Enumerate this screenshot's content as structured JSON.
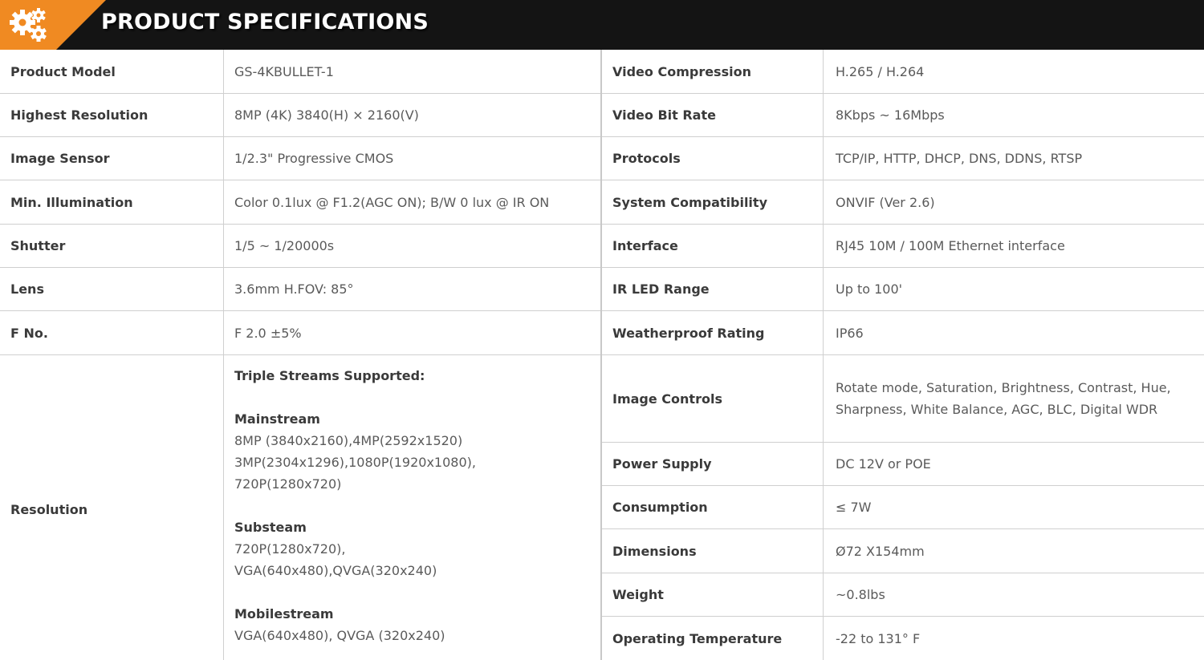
{
  "header": {
    "title": "PRODUCT SPECIFICATIONS",
    "accent_color": "#f08a22",
    "icon": "gears-icon"
  },
  "left_specs": [
    {
      "label": "Product Model",
      "value": "GS-4KBULLET-1"
    },
    {
      "label": "Highest Resolution",
      "value": "8MP (4K)  3840(H) × 2160(V)"
    },
    {
      "label": "Image Sensor",
      "value": "1/2.3\" Progressive CMOS"
    },
    {
      "label": "Min. Illumination",
      "value": "Color 0.1lux @ F1.2(AGC ON);  B/W 0 lux @ IR ON"
    },
    {
      "label": "Shutter",
      "value": "1/5 ~ 1/20000s"
    },
    {
      "label": "Lens",
      "value": "3.6mm H.FOV: 85°"
    },
    {
      "label": "F No.",
      "value": "F 2.0 ±5%"
    }
  ],
  "resolution": {
    "label": "Resolution",
    "heading": "Triple Streams Supported:",
    "main_title": "Mainstream",
    "main_lines": [
      "8MP (3840x2160),4MP(2592x1520)",
      "3MP(2304x1296),1080P(1920x1080),",
      "720P(1280x720)"
    ],
    "sub_title": "Substeam",
    "sub_lines": [
      "720P(1280x720),",
      "VGA(640x480),QVGA(320x240)"
    ],
    "mobile_title": "Mobilestream",
    "mobile_lines": [
      "VGA(640x480), QVGA (320x240)"
    ]
  },
  "right_specs": [
    {
      "label": "Video Compression",
      "value": "H.265 / H.264"
    },
    {
      "label": "Video Bit Rate",
      "value": "8Kbps ~ 16Mbps"
    },
    {
      "label": "Protocols",
      "value": "TCP/IP, HTTP, DHCP, DNS, DDNS, RTSP"
    },
    {
      "label": "System Compatibility",
      "value": "ONVIF (Ver 2.6)"
    },
    {
      "label": "Interface",
      "value": "RJ45 10M / 100M Ethernet interface"
    },
    {
      "label": "IR LED Range",
      "value": "Up to 100'"
    },
    {
      "label": "Weatherproof Rating",
      "value": "IP66"
    }
  ],
  "image_controls": {
    "label": "Image Controls",
    "lines": [
      "Rotate mode, Saturation, Brightness, Contrast, Hue,",
      "Sharpness, White Balance, AGC, BLC, Digital WDR"
    ]
  },
  "right_specs_2": [
    {
      "label": "Power Supply",
      "value": "DC 12V or POE"
    },
    {
      "label": "Consumption",
      "value": "≤ 7W"
    },
    {
      "label": "Dimensions",
      "value": "Ø72 X154mm"
    },
    {
      "label": "Weight",
      "value": "~0.8lbs"
    },
    {
      "label": "Operating Temperature",
      "value": "-22 to 131° F"
    }
  ]
}
